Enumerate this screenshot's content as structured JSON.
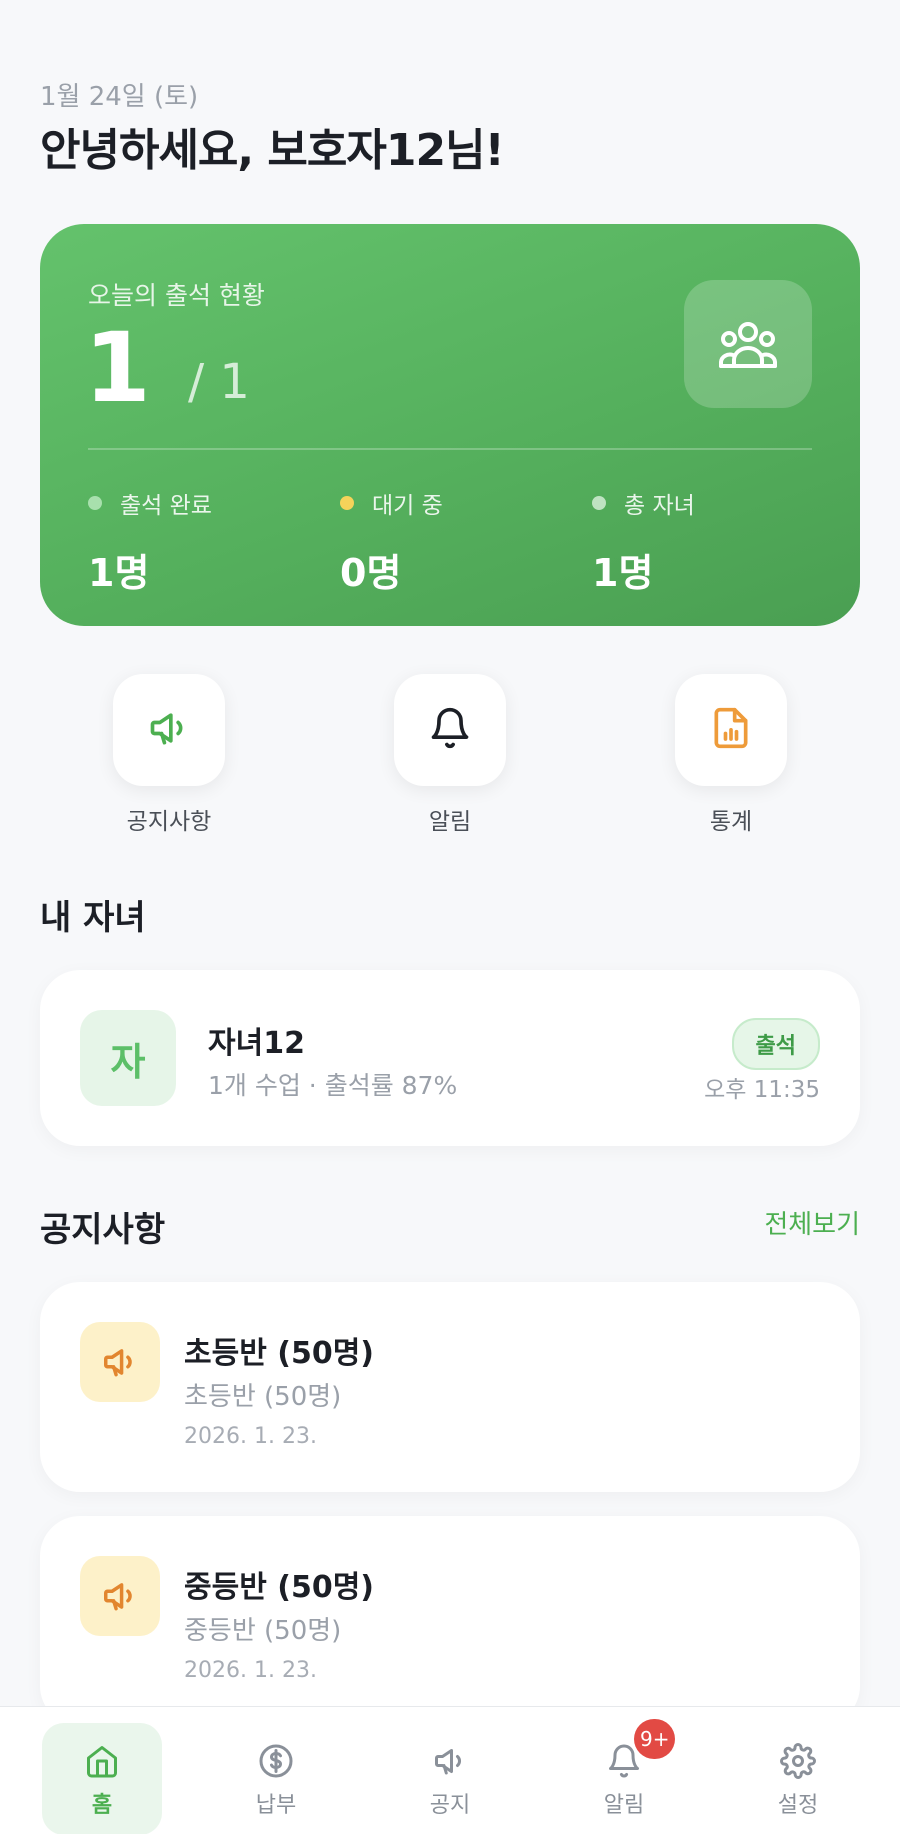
{
  "header": {
    "date": "1월 24일 (토)",
    "greeting": "안녕하세요, 보호자12님!"
  },
  "summary": {
    "title": "오늘의 출석 현황",
    "attended": "1",
    "total": "/ 1",
    "stats": [
      {
        "label": "출석 완료",
        "value": "1명",
        "dot_color": "#a8e0ad"
      },
      {
        "label": "대기 중",
        "value": "0명",
        "dot_color": "#f5d35a"
      },
      {
        "label": "총 자녀",
        "value": "1명",
        "dot_color": "#bfe3c2"
      }
    ]
  },
  "quick_actions": [
    {
      "label": "공지사항",
      "icon": "megaphone-icon"
    },
    {
      "label": "알림",
      "icon": "bell-icon"
    },
    {
      "label": "통계",
      "icon": "report-icon"
    }
  ],
  "children_section": {
    "title": "내 자녀",
    "child": {
      "avatar": "자",
      "name": "자녀12",
      "subtitle": "1개 수업 · 출석률 87%",
      "status": "출석",
      "time": "오후 11:35"
    }
  },
  "notices_section": {
    "title": "공지사항",
    "see_all": "전체보기",
    "items": [
      {
        "title": "초등반 (50명)",
        "subtitle": "초등반 (50명)",
        "date": "2026. 1. 23."
      },
      {
        "title": "중등반 (50명)",
        "subtitle": "중등반 (50명)",
        "date": "2026. 1. 23."
      }
    ]
  },
  "tabbar": {
    "tabs": [
      {
        "label": "홈",
        "icon": "home-icon",
        "active": true
      },
      {
        "label": "납부",
        "icon": "dollar-icon"
      },
      {
        "label": "공지",
        "icon": "megaphone-icon"
      },
      {
        "label": "알림",
        "icon": "bell-icon",
        "badge": "9+"
      },
      {
        "label": "설정",
        "icon": "gear-icon"
      }
    ]
  },
  "colors": {
    "accent": "#4caf50",
    "card_gradient_start": "#64c26c",
    "card_gradient_end": "#4a9f52",
    "badge_red": "#e24a44"
  }
}
